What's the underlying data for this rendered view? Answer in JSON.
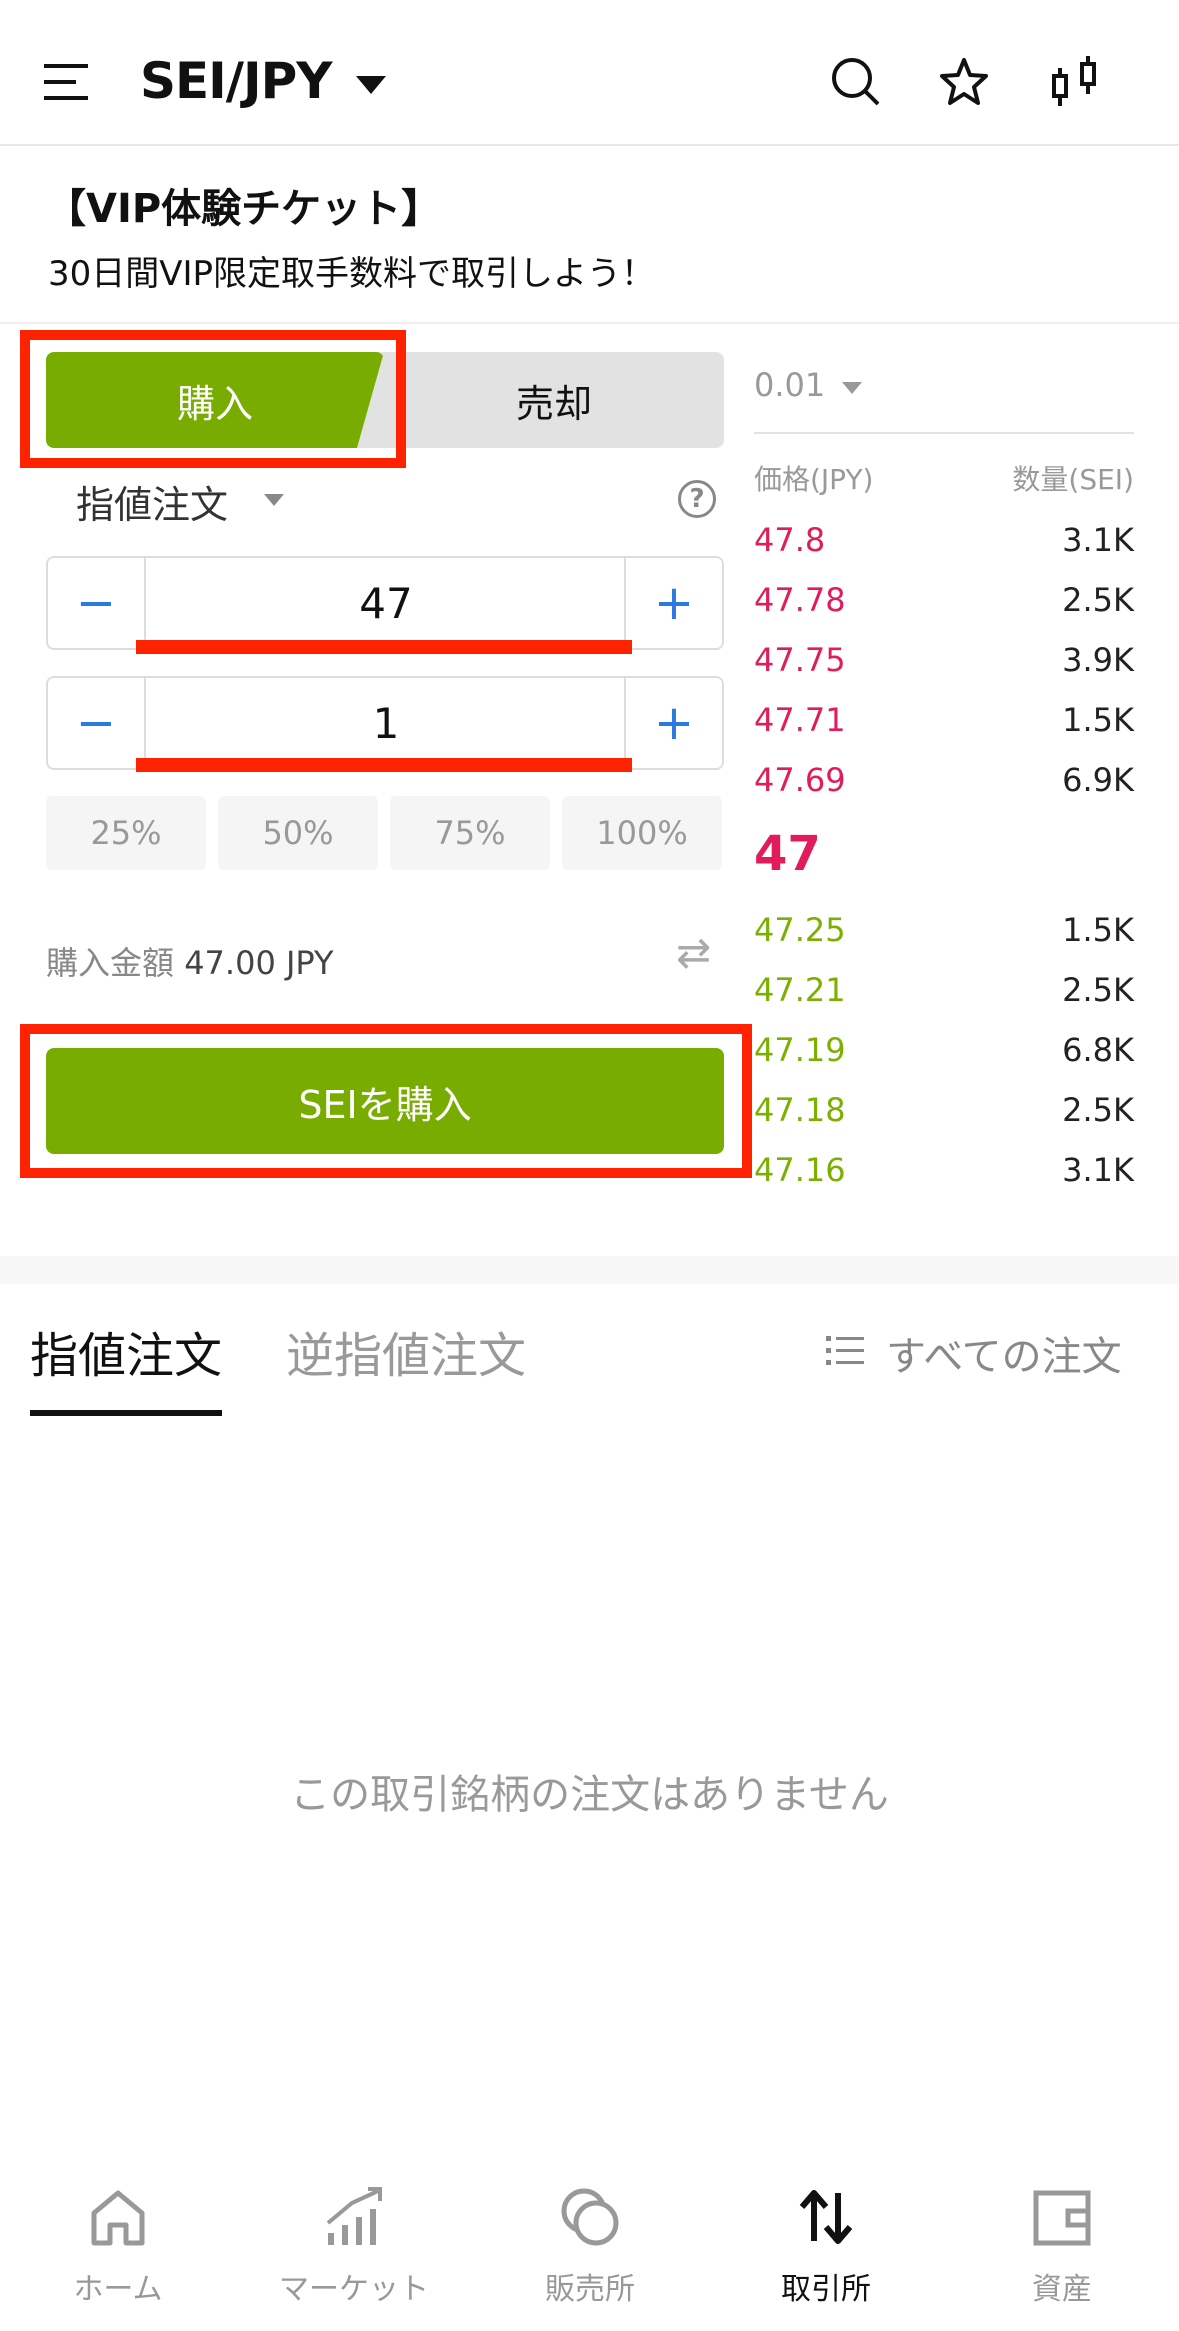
{
  "header": {
    "pair": "SEI/JPY",
    "icons": [
      "menu-icon",
      "search-icon",
      "star-icon",
      "candlestick-icon"
    ]
  },
  "banner": {
    "title": "【VIP体験チケット】",
    "subtitle": "30日間VIP限定取手数料で取引しよう！"
  },
  "trade": {
    "buy_tab": "購入",
    "sell_tab": "売却",
    "order_type": "指値注文",
    "help": "?",
    "price_value": "47",
    "qty_value": "1",
    "minus": "−",
    "plus": "+",
    "percents": [
      "25%",
      "50%",
      "75%",
      "100%"
    ],
    "amount_label": "購入金額",
    "amount_value": "47.00 JPY",
    "submit": "SEIを購入"
  },
  "orderbook": {
    "tick": "0.01",
    "price_header": "価格(JPY)",
    "qty_header": "数量(SEI)",
    "asks": [
      {
        "price": "47.8",
        "qty": "3.1K"
      },
      {
        "price": "47.78",
        "qty": "2.5K"
      },
      {
        "price": "47.75",
        "qty": "3.9K"
      },
      {
        "price": "47.71",
        "qty": "1.5K"
      },
      {
        "price": "47.69",
        "qty": "6.9K"
      }
    ],
    "last": "47",
    "bids": [
      {
        "price": "47.25",
        "qty": "1.5K"
      },
      {
        "price": "47.21",
        "qty": "2.5K"
      },
      {
        "price": "47.19",
        "qty": "6.8K"
      },
      {
        "price": "47.18",
        "qty": "2.5K"
      },
      {
        "price": "47.16",
        "qty": "3.1K"
      }
    ]
  },
  "orders": {
    "tab_limit": "指値注文",
    "tab_stop": "逆指値注文",
    "all_orders": "すべての注文",
    "empty": "この取引銘柄の注文はありません"
  },
  "nav": [
    {
      "label": "ホーム",
      "icon": "home-icon"
    },
    {
      "label": "マーケット",
      "icon": "market-icon"
    },
    {
      "label": "販売所",
      "icon": "exchange-shop-icon"
    },
    {
      "label": "取引所",
      "icon": "trade-arrows-icon"
    },
    {
      "label": "資産",
      "icon": "wallet-icon"
    }
  ],
  "colors": {
    "accent": "#78ac00",
    "ask": "#e01c5a",
    "highlight": "#ff2200",
    "link": "#2a7ae2"
  }
}
